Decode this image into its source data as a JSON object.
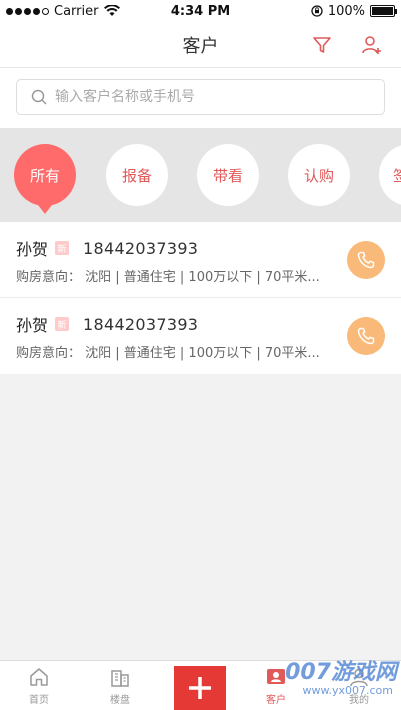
{
  "status_bar": {
    "carrier": "Carrier",
    "time": "4:34 PM",
    "battery": "100%",
    "signal_dots_filled": 4
  },
  "nav": {
    "title": "客户",
    "filter_icon": "filter-icon",
    "add_icon": "add-user-icon"
  },
  "search": {
    "placeholder": "输入客户名称或手机号",
    "value": ""
  },
  "chips": [
    {
      "label": "所有",
      "active": true
    },
    {
      "label": "报备",
      "active": false
    },
    {
      "label": "带看",
      "active": false
    },
    {
      "label": "认购",
      "active": false
    },
    {
      "label": "签",
      "active": false
    }
  ],
  "customers": [
    {
      "name": "孙贺",
      "badge": "新",
      "phone": "18442037393",
      "intent": "购房意向： 沈阳 | 普通住宅 | 100万以下 | 70平米..."
    },
    {
      "name": "孙贺",
      "badge": "新",
      "phone": "18442037393",
      "intent": "购房意向： 沈阳 | 普通住宅 | 100万以下 | 70平米..."
    }
  ],
  "tabbar": {
    "home": "首页",
    "building": "楼盘",
    "plus_icon": "plus-icon",
    "customer": "客户",
    "mine": "我的"
  },
  "watermark": {
    "brand": "007游戏网",
    "url": "www.yx007.com"
  },
  "colors": {
    "accent": "#ff6b6b",
    "call": "#f9b978",
    "plus": "#e53935"
  }
}
